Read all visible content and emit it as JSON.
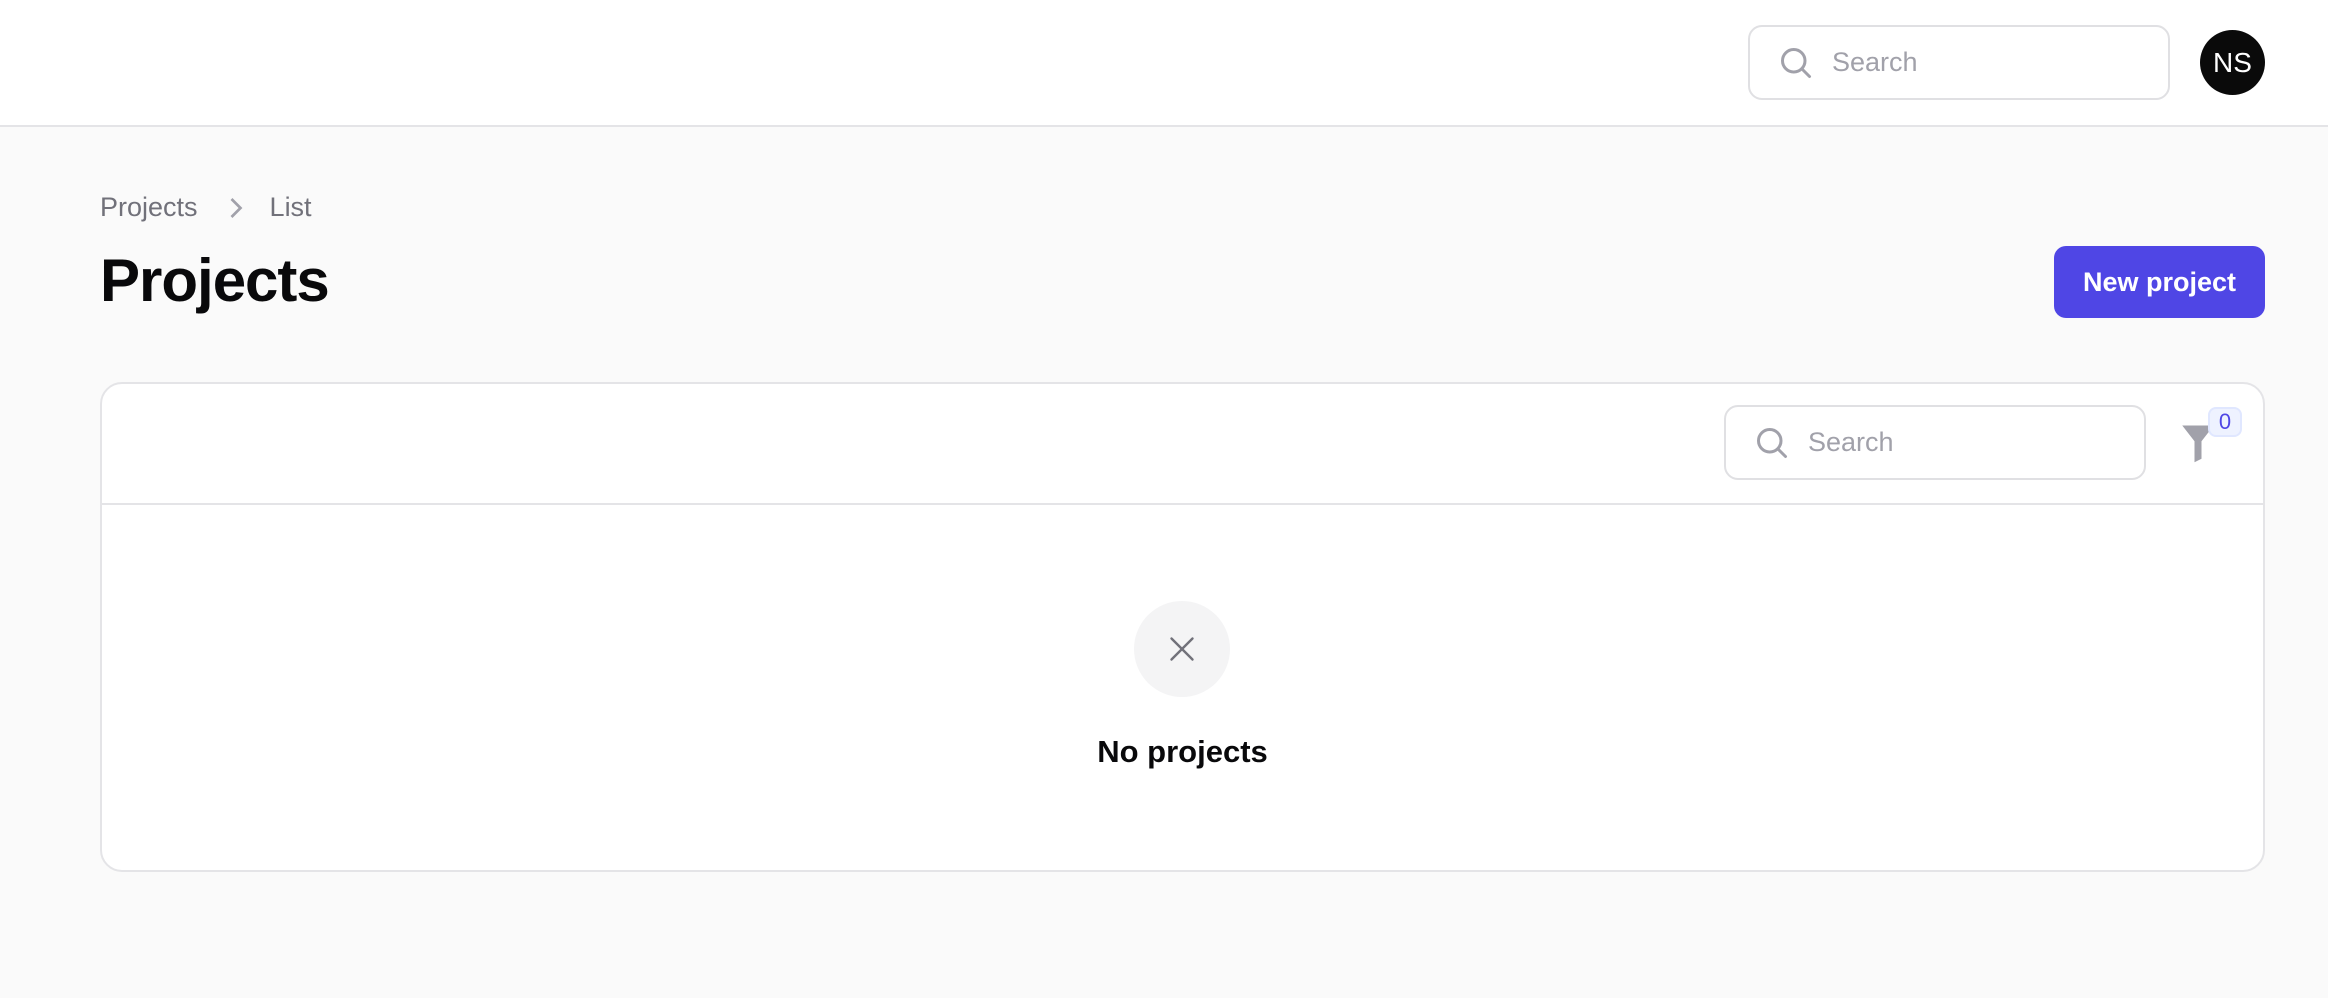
{
  "header": {
    "search_placeholder": "Search",
    "avatar_initials": "NS"
  },
  "breadcrumb": [
    "Projects",
    "List"
  ],
  "page": {
    "title": "Projects",
    "new_button_label": "New project"
  },
  "table": {
    "search_placeholder": "Search",
    "filter_count": "0",
    "empty_message": "No projects"
  },
  "colors": {
    "accent": "#4f46e5",
    "avatar_bg": "#0a0a0a"
  }
}
